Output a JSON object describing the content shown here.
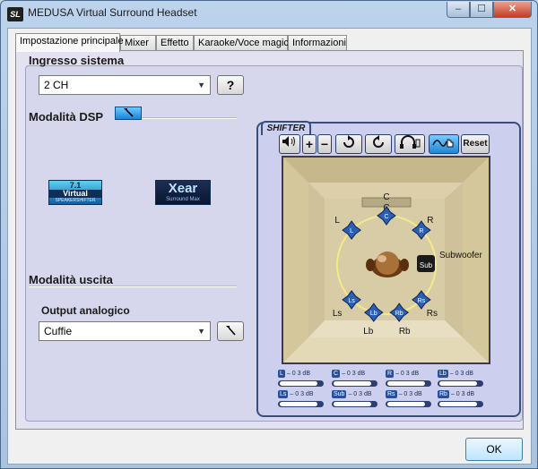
{
  "window": {
    "title": "MEDUSA Virtual Surround Headset",
    "icon_text": "SL"
  },
  "controls": {
    "minimize": "–",
    "maximize": "☐",
    "close": "✕"
  },
  "tabs": [
    {
      "label": "Impostazione principale",
      "active": true
    },
    {
      "label": "Mixer",
      "active": false
    },
    {
      "label": "Effetto",
      "active": false
    },
    {
      "label": "Karaoke/Voce magica",
      "active": false
    },
    {
      "label": "Informazioni",
      "active": false
    }
  ],
  "input": {
    "section_title": "Ingresso sistema",
    "selected": "2 CH",
    "help_label": "?"
  },
  "dsp": {
    "label": "Modalità DSP",
    "logo_virtual": {
      "top": "7.1",
      "main": "Virtual",
      "sub": "SPEAKERSHIFTER"
    },
    "logo_xear": {
      "main": "Xear",
      "sub": "Surround Max"
    }
  },
  "output": {
    "section_title": "Modalità uscita",
    "label": "Output analogico",
    "selected": "Cuffie"
  },
  "shifter": {
    "title": "SHIFTER",
    "reset_label": "Reset",
    "speaker_top_label": "C",
    "speakers": [
      {
        "label": "L",
        "icon": "L"
      },
      {
        "label": "C",
        "icon": "C"
      },
      {
        "label": "R",
        "icon": "R"
      },
      {
        "label": "Subwoofer",
        "icon": "Sub"
      },
      {
        "label": "Ls",
        "icon": "Ls"
      },
      {
        "label": "Lb",
        "icon": "Lb"
      },
      {
        "label": "Rb",
        "icon": "Rb"
      },
      {
        "label": "Rs",
        "icon": "Rs"
      }
    ]
  },
  "levels": [
    {
      "label": "L",
      "value": "– 0 3 dB",
      "fill": 0.9
    },
    {
      "label": "C",
      "value": "– 0 3 dB",
      "fill": 0.9
    },
    {
      "label": "R",
      "value": "– 0 3 dB",
      "fill": 0.9
    },
    {
      "label": "Lb",
      "value": "– 0 3 dB",
      "fill": 0.9
    },
    {
      "label": "Ls",
      "value": "– 0 3 dB",
      "fill": 0.9
    },
    {
      "label": "Sub",
      "value": "– 0 3 dB",
      "fill": 0.9
    },
    {
      "label": "Rs",
      "value": "– 0 3 dB",
      "fill": 0.9
    },
    {
      "label": "Rb",
      "value": "– 0 3 dB",
      "fill": 0.9
    }
  ],
  "ok_label": "OK"
}
